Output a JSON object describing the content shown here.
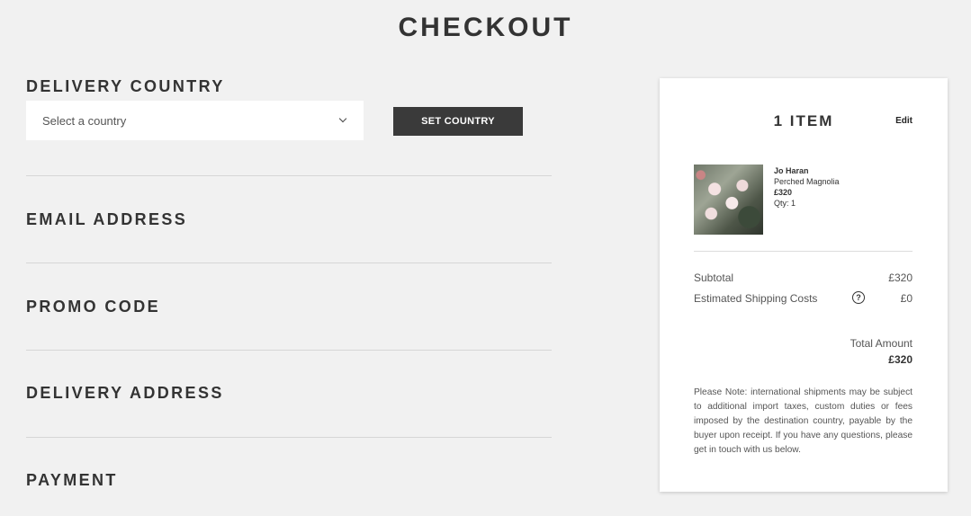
{
  "page": {
    "title": "CHECKOUT"
  },
  "delivery_country": {
    "heading": "DELIVERY COUNTRY",
    "select_placeholder": "Select a country",
    "button_label": "SET COUNTRY"
  },
  "sections": {
    "email": "EMAIL ADDRESS",
    "promo": "PROMO CODE",
    "delivery_address": "DELIVERY ADDRESS",
    "payment": "PAYMENT"
  },
  "summary": {
    "items_title": "1 ITEM",
    "edit_label": "Edit",
    "item": {
      "artist": "Jo Haran",
      "title": "Perched Magnolia",
      "price": "£320",
      "qty": "Qty: 1"
    },
    "subtotal_label": "Subtotal",
    "subtotal_value": "£320",
    "shipping_label": "Estimated Shipping Costs",
    "shipping_help": "?",
    "shipping_value": "£0",
    "total_label": "Total Amount",
    "total_value": "£320",
    "note": "Please Note: international shipments may be subject to additional import taxes, custom duties or fees imposed by the destination country, payable by the buyer upon receipt. If you have any questions, please get in touch with us below."
  }
}
